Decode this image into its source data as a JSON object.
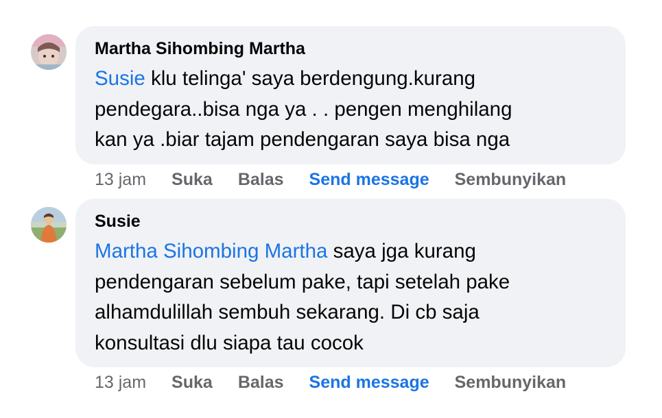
{
  "comments": [
    {
      "author": "Martha Sihombing Martha",
      "mention": "Susie",
      "text": " klu telinga' saya berdengung.kurang\npendegara..bisa nga ya . . pengen menghilang\nkan ya .biar tajam pendengaran saya bisa nga",
      "time": "13 jam",
      "like": "Suka",
      "reply": "Balas",
      "send": "Send message",
      "hide": "Sembunyikan"
    },
    {
      "author": "Susie",
      "mention": "Martha Sihombing Martha",
      "text": " saya jga kurang\npendengaran sebelum pake, tapi setelah pake\nalhamdulillah sembuh sekarang. Di cb saja\nkonsultasi dlu siapa tau cocok",
      "time": "13 jam",
      "like": "Suka",
      "reply": "Balas",
      "send": "Send message",
      "hide": "Sembunyikan"
    }
  ],
  "colors": {
    "bubble": "#f0f2f5",
    "mention": "#1b74e4",
    "meta": "#65676b",
    "text": "#050505"
  }
}
